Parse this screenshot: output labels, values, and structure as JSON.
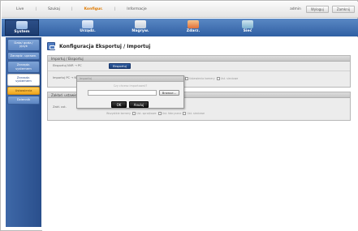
{
  "topnav": {
    "items": [
      "Live",
      "Szukaj",
      "Konfigur.",
      "Informacje"
    ],
    "active_index": 2,
    "user": "admin",
    "buttons": [
      "Wyloguj",
      "Zamknij"
    ]
  },
  "tabs": [
    {
      "label": "System",
      "icon": "system-monitor-icon",
      "selected": true
    },
    {
      "label": "Urządz.",
      "icon": "device-icon",
      "selected": false
    },
    {
      "label": "Nagryw.",
      "icon": "record-icon",
      "selected": false
    },
    {
      "label": "Zdarz.",
      "icon": "event-icon",
      "selected": false
    },
    {
      "label": "Sieć",
      "icon": "network-icon",
      "selected": false
    }
  ],
  "sidebar": {
    "items": [
      {
        "label": "Data/ godz./ język",
        "style": "blue"
      },
      {
        "label": "Zarządz. uprawn.",
        "style": "blue"
      },
      {
        "label": "Zarządz. systemem",
        "style": "blue"
      },
      {
        "label": "Zarządz. systemem",
        "style": "white"
      },
      {
        "label": "Ustawienia",
        "style": "orange"
      },
      {
        "label": "Dziennik",
        "style": "blue"
      }
    ]
  },
  "page": {
    "title": "Konfiguracja Eksportuj / Importuj"
  },
  "panel1": {
    "header": "Importuj / Eksportuj",
    "row1_label": "Eksportuj NVR → PC",
    "row1_button": "Eksportuj",
    "row2_label": "Importuj PC → NVR",
    "row2_option1": "Ustawienia kamery",
    "row2_option2": "Ust. sieciowe"
  },
  "panel2": {
    "header": "Zakład. ustawień",
    "row_label": "Zakł. ust.",
    "opt1": "Wszystkie kamery",
    "opt2": "Ust. sprzętowe",
    "opt3": "Ust. fabryczne",
    "opt4": "Ust. sieciowe"
  },
  "dialog": {
    "title": "Importuj",
    "subtitle": "Czy chcesz importować?",
    "file_value": "",
    "browse_label": "Browse...",
    "ok_label": "OK",
    "cancel_label": "Anuluj"
  },
  "colors": {
    "band": "#2f5fa3",
    "accent": "#e07a00"
  }
}
